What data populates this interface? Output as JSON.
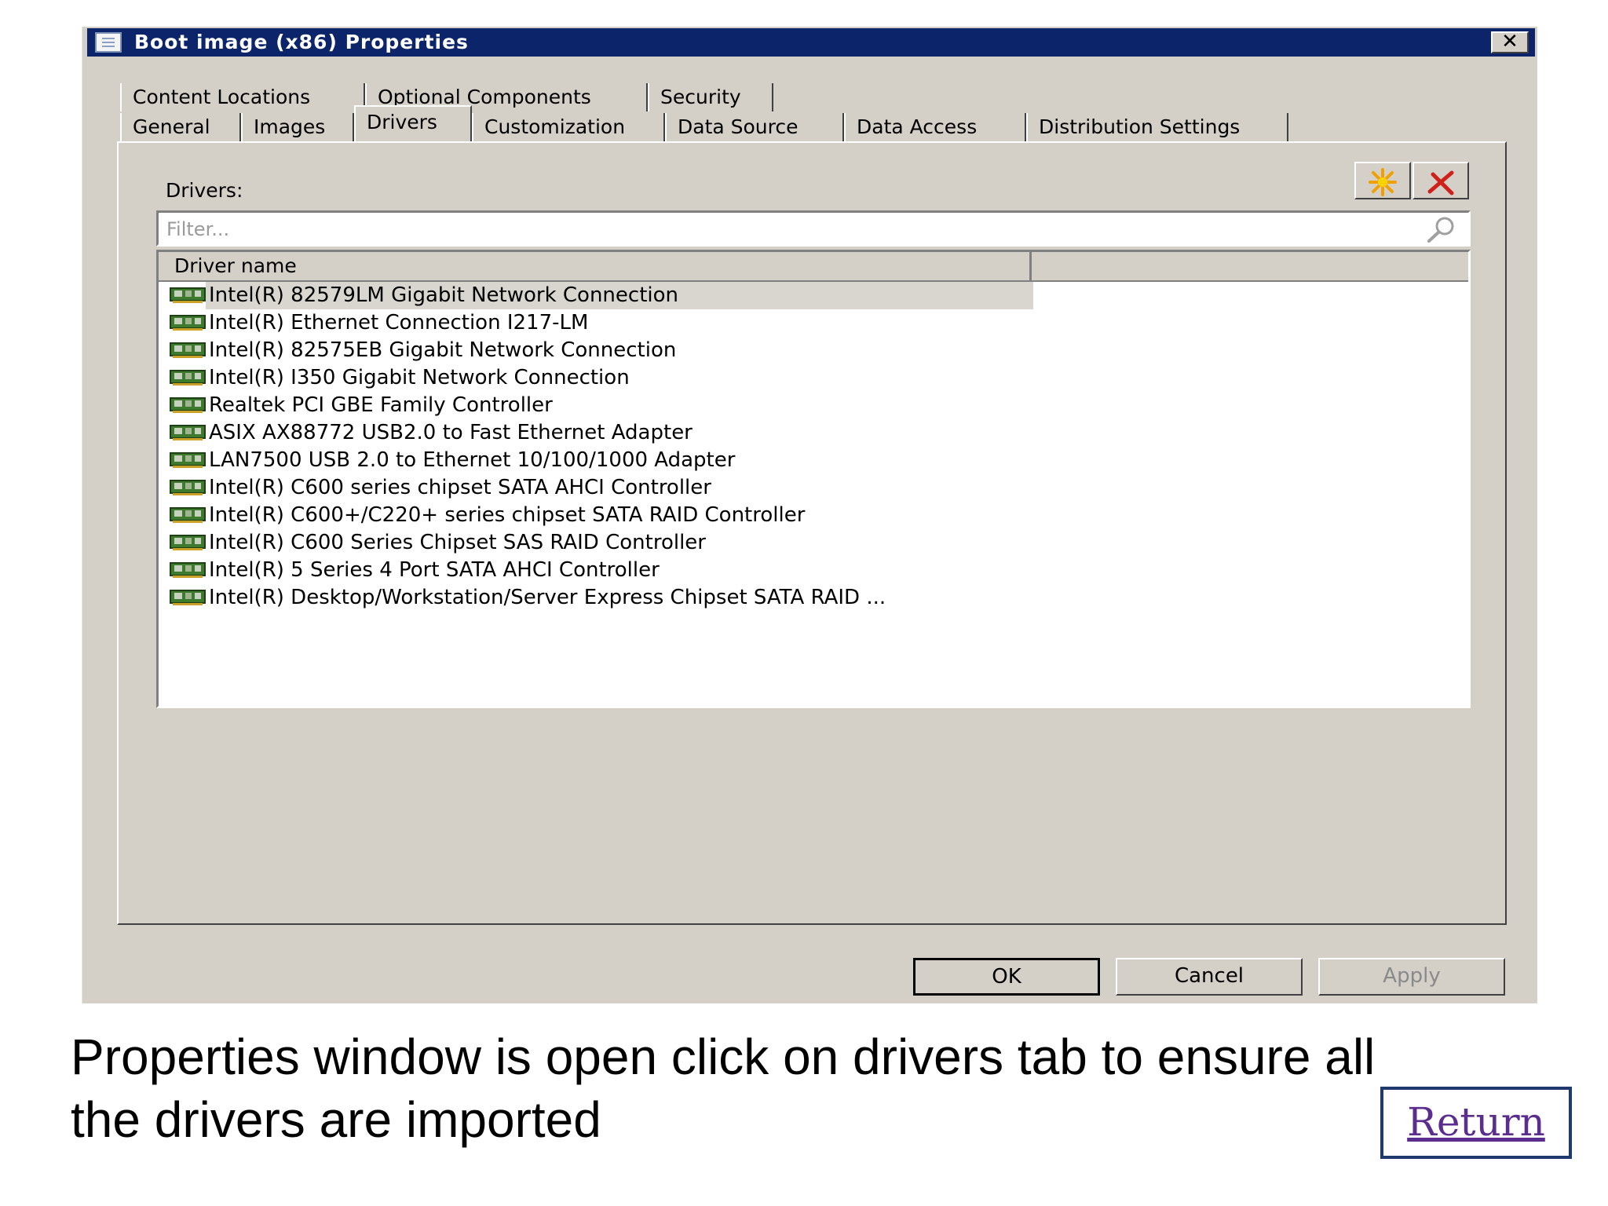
{
  "window": {
    "title": "Boot image (x86) Properties",
    "close_label": "✕"
  },
  "tabs_row1": [
    {
      "label": "Content Locations"
    },
    {
      "label": "Optional Components"
    },
    {
      "label": "Security"
    }
  ],
  "tabs_row2": [
    {
      "label": "General"
    },
    {
      "label": "Images"
    },
    {
      "label": "Drivers"
    },
    {
      "label": "Customization"
    },
    {
      "label": "Data Source"
    },
    {
      "label": "Data Access"
    },
    {
      "label": "Distribution Settings"
    }
  ],
  "active_tab": "Drivers",
  "drivers": {
    "label": "Drivers:",
    "filter_placeholder": "Filter...",
    "column_header": "Driver name",
    "rows": [
      {
        "name": "Intel(R) 82579LM Gigabit Network Connection"
      },
      {
        "name": "Intel(R) Ethernet Connection I217-LM"
      },
      {
        "name": "Intel(R) 82575EB Gigabit Network Connection"
      },
      {
        "name": "Intel(R) I350 Gigabit Network Connection"
      },
      {
        "name": "Realtek PCI GBE Family Controller"
      },
      {
        "name": "ASIX AX88772 USB2.0 to Fast Ethernet Adapter"
      },
      {
        "name": "LAN7500 USB 2.0 to Ethernet 10/100/1000 Adapter"
      },
      {
        "name": "Intel(R) C600 series chipset SATA AHCI Controller"
      },
      {
        "name": "Intel(R) C600+/C220+ series chipset SATA RAID Controller"
      },
      {
        "name": "Intel(R) C600 Series Chipset SAS RAID Controller"
      },
      {
        "name": "Intel(R) 5 Series 4 Port SATA AHCI Controller"
      },
      {
        "name": "Intel(R) Desktop/Workstation/Server Express Chipset SATA RAID ..."
      }
    ]
  },
  "buttons": {
    "ok": "OK",
    "cancel": "Cancel",
    "apply": "Apply"
  },
  "caption": "Properties window is open click on drivers tab to ensure all the drivers are imported",
  "return_link": "Return",
  "colors": {
    "titlebar": "#0b246a",
    "dialog_bg": "#d4d0c8",
    "return_border": "#1f3b6e",
    "link": "#5b2d8e"
  }
}
